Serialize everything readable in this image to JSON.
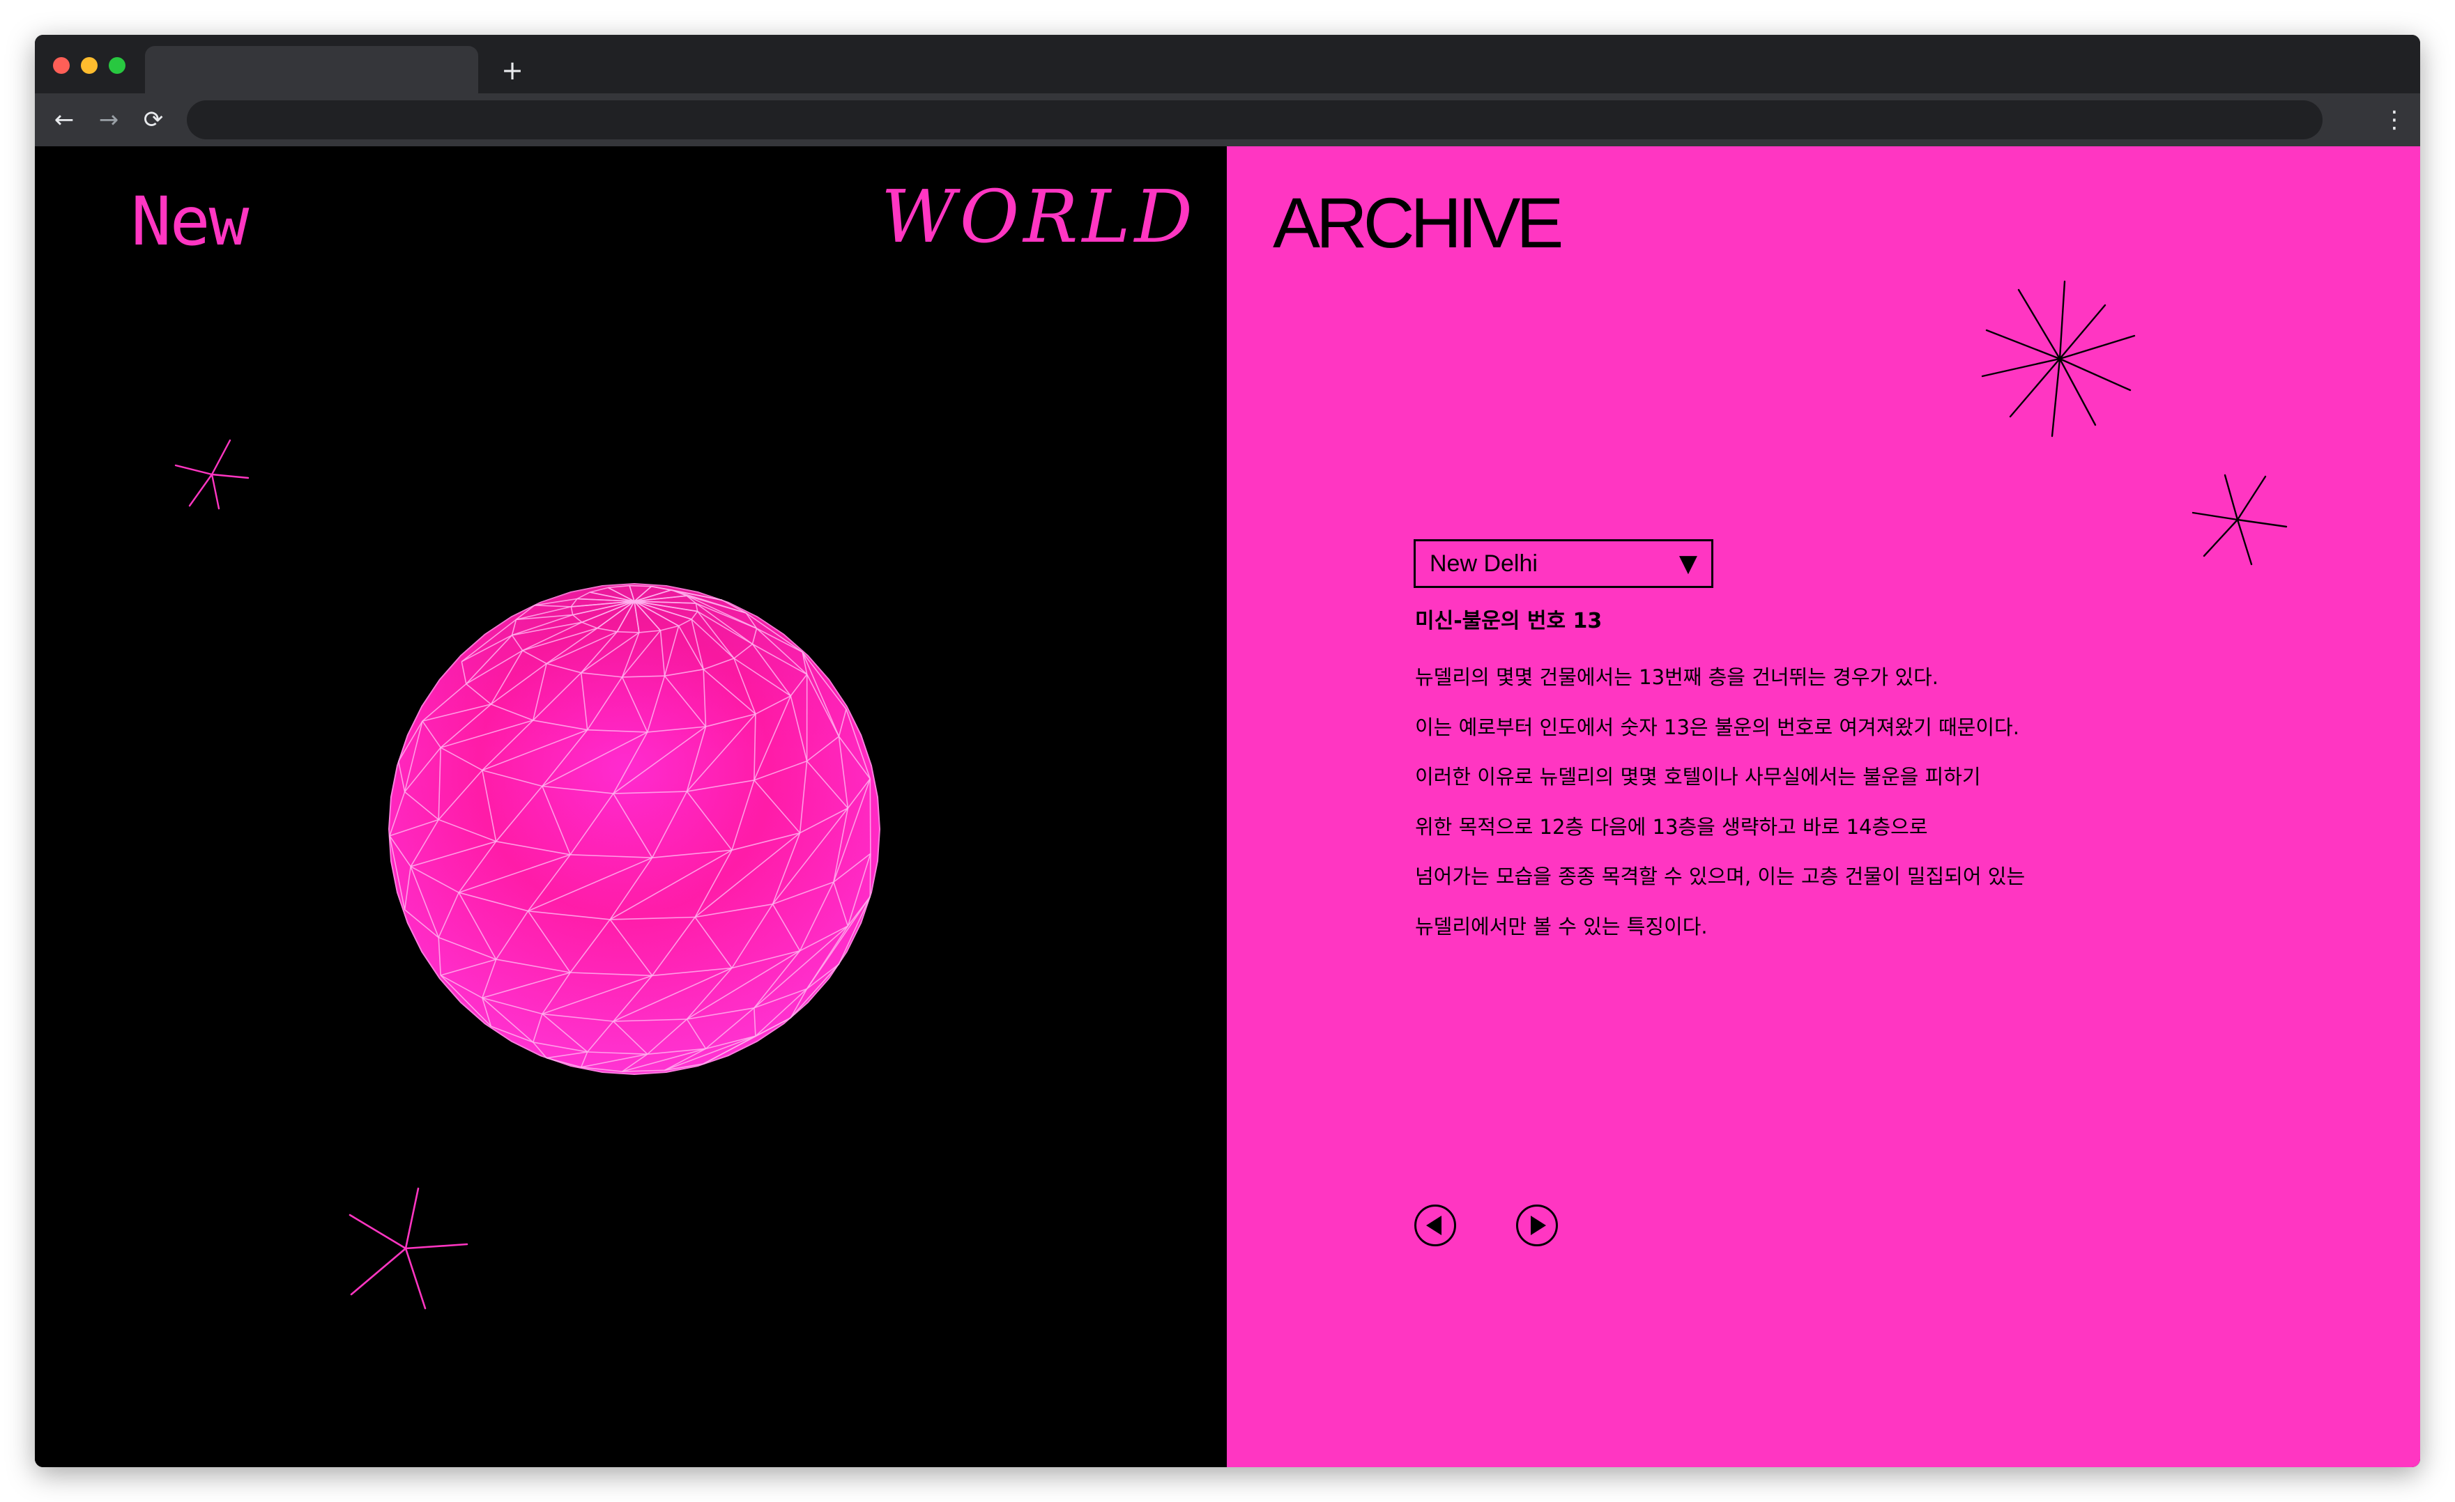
{
  "browser": {
    "new_tab_glyph": "+",
    "back_glyph": "←",
    "forward_glyph": "→",
    "reload_glyph": "⟳",
    "menu_glyph": "⋮"
  },
  "brand": {
    "word_new": "New",
    "word_world": "WORLD",
    "word_archive": "ARCHIVE"
  },
  "colors": {
    "accent_pink": "#ff36c2",
    "left_background": "#000000",
    "text_dark": "#000000"
  },
  "city_select": {
    "value": "New Delhi",
    "arrow_glyph": "▼"
  },
  "article": {
    "title": "미신-불운의 번호 13",
    "lines": [
      "뉴델리의 몇몇 건물에서는 13번째 층을 건너뛰는 경우가 있다.",
      "이는 예로부터 인도에서 숫자 13은 불운의 번호로 여겨져왔기 때문이다.",
      "이러한 이유로 뉴델리의 몇몇 호텔이나 사무실에서는 불운을 피하기",
      "위한 목적으로 12층 다음에 13층을 생략하고 바로 14층으로",
      "넘어가는 모습을 종종 목격할 수 있으며, 이는 고층 건물이 밀집되어 있는",
      "뉴델리에서만 볼 수 있는 특징이다."
    ]
  },
  "icons": {
    "prev": "play-left-icon",
    "next": "play-right-icon",
    "globe": "wireframe-globe",
    "sparkle": "sparkle-icon"
  }
}
